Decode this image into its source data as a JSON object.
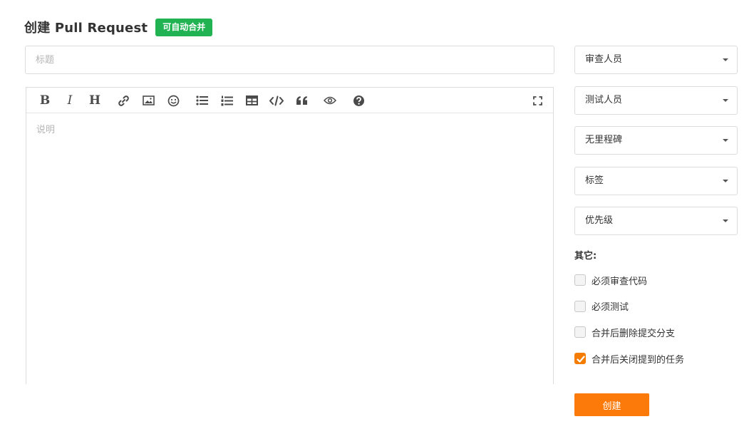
{
  "header": {
    "title": "创建 Pull Request",
    "badge": "可自动合并"
  },
  "form": {
    "title_placeholder": "标题",
    "title_value": "",
    "description_placeholder": "说明",
    "description_value": ""
  },
  "toolbar": {
    "bold": "B",
    "italic": "I",
    "heading": "H",
    "icons": [
      "bold-icon",
      "italic-icon",
      "heading-icon",
      "link-icon",
      "image-icon",
      "emoji-icon",
      "bullet-list-icon",
      "numbered-list-icon",
      "table-icon",
      "code-icon",
      "quote-icon",
      "preview-icon",
      "help-icon",
      "fullscreen-icon"
    ]
  },
  "sidebar": {
    "selects": [
      {
        "label": "审查人员"
      },
      {
        "label": "测试人员"
      },
      {
        "label": "无里程碑"
      },
      {
        "label": "标签"
      },
      {
        "label": "优先级"
      }
    ],
    "other_label": "其它:",
    "options": [
      {
        "label": "必须审查代码",
        "checked": false
      },
      {
        "label": "必须测试",
        "checked": false
      },
      {
        "label": "合并后删除提交分支",
        "checked": false
      },
      {
        "label": "合并后关闭提到的任务",
        "checked": true
      }
    ]
  },
  "actions": {
    "create_label": "创建"
  },
  "colors": {
    "badge_green": "#21b351",
    "accent_orange": "#fb7a0a",
    "checkbox_orange": "#f57c00"
  }
}
